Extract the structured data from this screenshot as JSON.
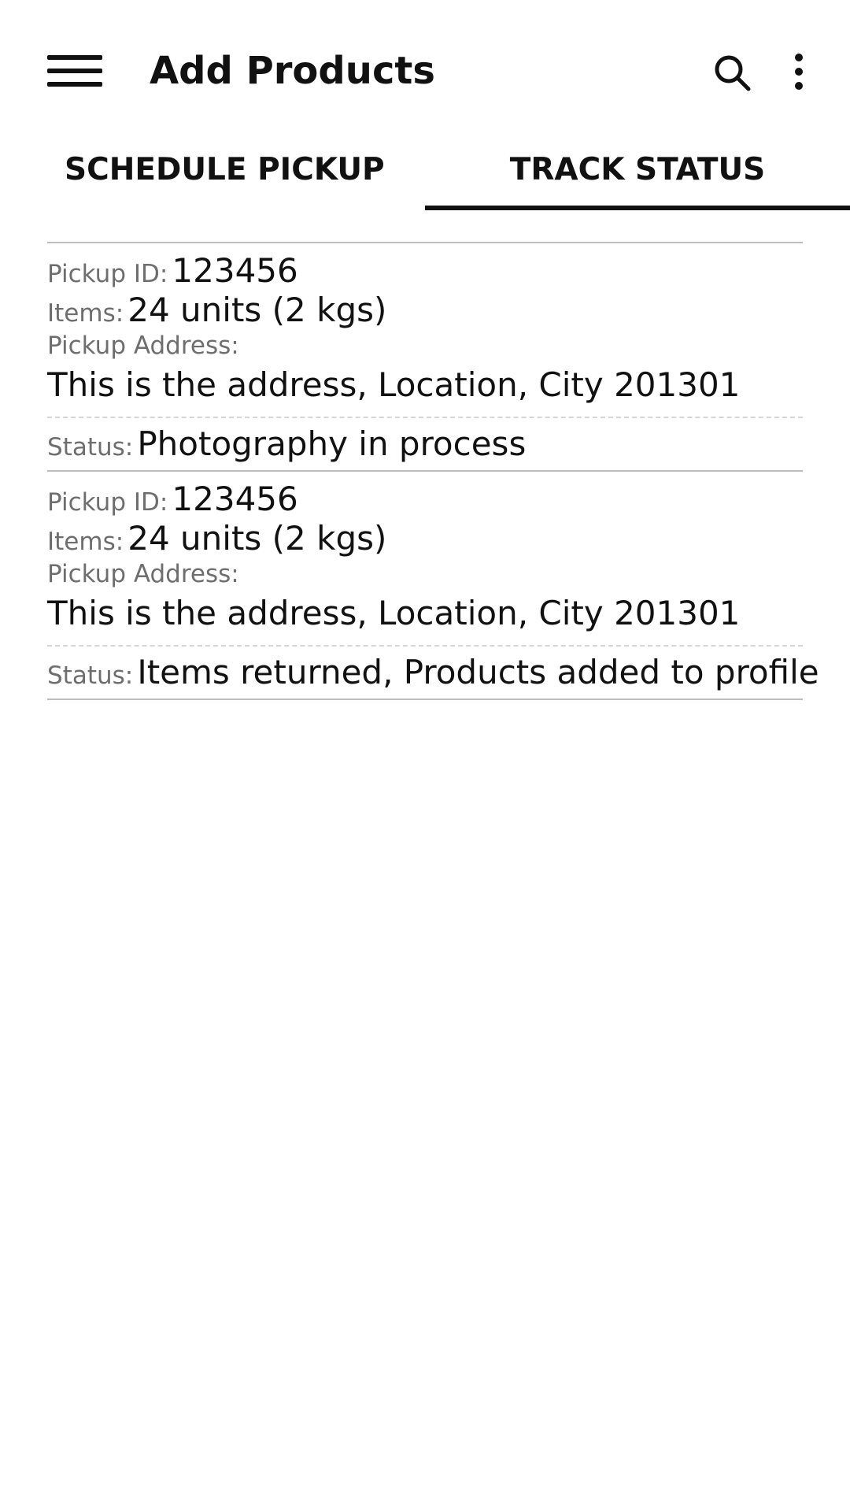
{
  "app_bar": {
    "title": "Add Products",
    "icons": [
      "menu-icon",
      "search-icon",
      "more-vert-icon"
    ]
  },
  "tabs": [
    {
      "label": "SCHEDULE PICKUP",
      "selected": false
    },
    {
      "label": "TRACK STATUS",
      "selected": true
    }
  ],
  "labels": {
    "pickup_id": "Pickup ID:",
    "items": "Items:",
    "pickup_address": "Pickup Address:",
    "status": "Status:"
  },
  "pickups": [
    {
      "pickup_id": "123456",
      "items": "24 units (2 kgs)",
      "address": "This is the address, Location, City 201301",
      "status": "Photography in process"
    },
    {
      "pickup_id": "123456",
      "items": "24 units (2 kgs)",
      "address": "This is the address, Location, City 201301",
      "status": "Items returned, Products added to profile"
    }
  ]
}
